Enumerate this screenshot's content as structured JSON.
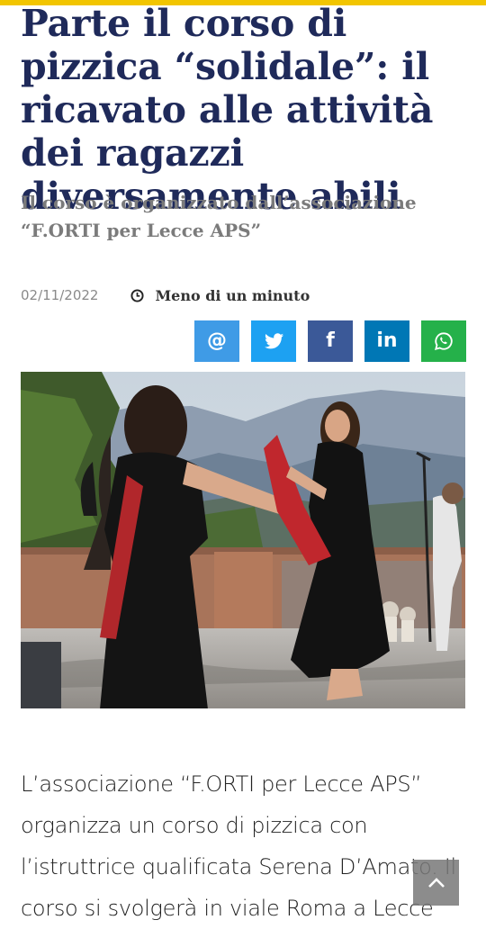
{
  "article": {
    "title": "Parte il corso di pizzica “solidale”: il ricavato alle attività dei ragazzi diversamente abili",
    "subtitle": "Il corso è organizzato dall’associazione “F.ORTI per Lecce APS”",
    "date": "02/11/2022",
    "reading_time": "Meno di un minuto",
    "body": "L’associazione “F.ORTI per Lecce APS” organizza un corso di pizzica con l’istruttrice qualificata Serena D’Amato. Il corso si svolgerà in viale Roma a Lecce"
  },
  "share": {
    "email_label": "@",
    "twitter_icon": "twitter-icon",
    "facebook_label": "f",
    "linkedin_label": "in",
    "whatsapp_icon": "whatsapp-icon"
  },
  "icons": {
    "reading_time": "clock-icon",
    "scroll_top": "chevron-up-icon"
  },
  "colors": {
    "accent_bar": "#f2c500",
    "headline": "#1f2a5a",
    "email": "#3f9be6",
    "twitter": "#1da1f2",
    "facebook": "#3b5998",
    "linkedin": "#0077b5",
    "whatsapp": "#25b14a"
  }
}
